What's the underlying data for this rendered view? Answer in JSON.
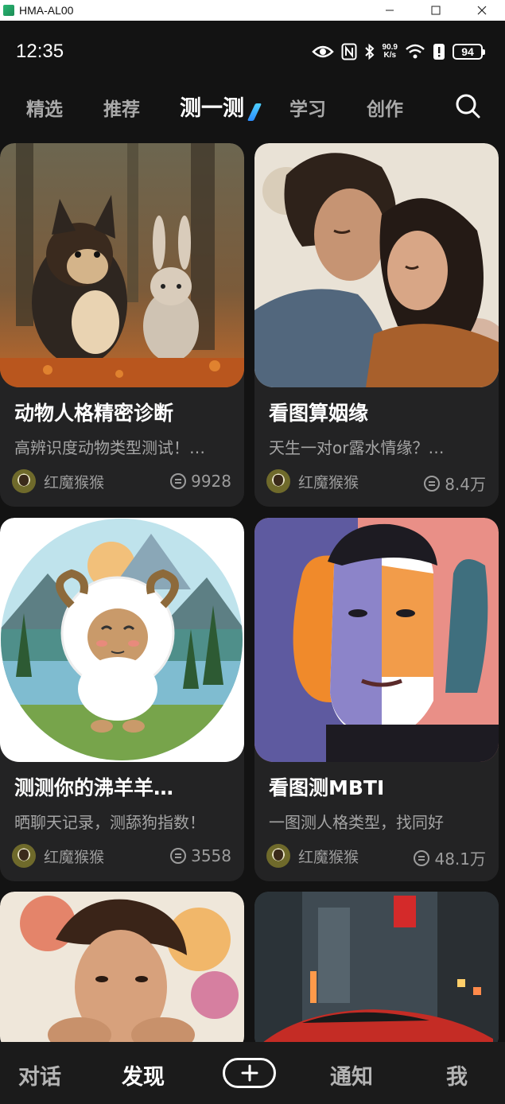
{
  "window": {
    "title": "HMA-AL00"
  },
  "status": {
    "time": "12:35",
    "net_speed_top": "90.9",
    "net_speed_bottom": "K/s",
    "battery": "94"
  },
  "tabs": [
    {
      "label": "精选"
    },
    {
      "label": "推荐"
    },
    {
      "label": "测一测"
    },
    {
      "label": "学习"
    },
    {
      "label": "创作"
    }
  ],
  "cards": [
    {
      "title": "动物人格精密诊断",
      "desc": "高辨识度动物类型测试！…",
      "author": "红魔猴猴",
      "count": "9928",
      "image": "puppy-and-rabbit-watercolor"
    },
    {
      "title": "看图算姻缘",
      "desc": "天生一对or露水情缘？…",
      "author": "红魔猴猴",
      "count": "8.4万",
      "image": "couple-watercolor"
    },
    {
      "title": "测测你的沸羊羊…",
      "desc": "晒聊天记录，测舔狗指数！",
      "author": "红魔猴猴",
      "count": "3558",
      "image": "cartoon-sheep-landscape"
    },
    {
      "title": "看图测MBTI",
      "desc": "一图测人格类型，找同好",
      "author": "红魔猴猴",
      "count": "48.1万",
      "image": "abstract-faces-portrait"
    },
    {
      "title": "",
      "desc": "",
      "author": "",
      "count": "",
      "image": "watercolor-man-portrait"
    },
    {
      "title": "",
      "desc": "",
      "author": "",
      "count": "",
      "image": "city-street-red-car"
    }
  ],
  "bottom_nav": {
    "chat": "对话",
    "discover": "发现",
    "notify": "通知",
    "me": "我"
  },
  "colors": {
    "background": "#131313",
    "card": "#232324",
    "accent": "#2b8cff",
    "muted_text": "#a5a5a5"
  }
}
